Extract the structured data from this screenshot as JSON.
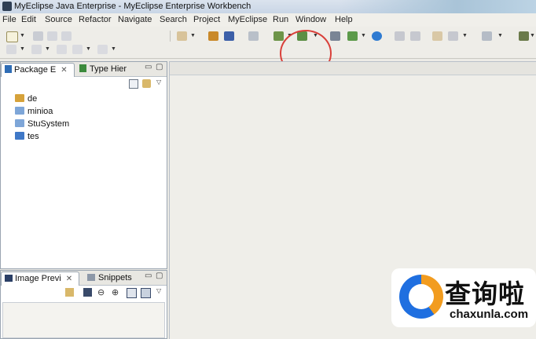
{
  "window": {
    "title": "MyEclipse Java Enterprise - MyEclipse Enterprise Workbench"
  },
  "menu": [
    "File",
    "Edit",
    "Source",
    "Refactor",
    "Navigate",
    "Search",
    "Project",
    "MyEclipse",
    "Run",
    "Window",
    "Help"
  ],
  "package_explorer": {
    "tabs": [
      "Package E",
      "Type Hier"
    ],
    "items": [
      "de",
      "minioa",
      "StuSystem",
      "tes"
    ]
  },
  "bottom_view": {
    "tabs": [
      "Image Previ",
      "Snippets"
    ]
  },
  "watermark": {
    "cn": "查询啦",
    "en": "chaxunla.com"
  },
  "colors": {
    "highlight_circle": "#d9403a",
    "editor_bg": "#efeee9"
  }
}
